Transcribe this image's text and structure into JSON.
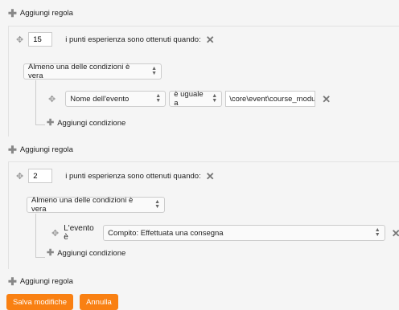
{
  "add_rule_label": "Aggiungi regola",
  "add_condition_label": "Aggiungi condizione",
  "rules": [
    {
      "points": "15",
      "obtained_text": "i punti esperienza sono ottenuti quando:",
      "mode": "Almeno una delle condizioni è vera",
      "condition": {
        "property": "Nome dell'evento",
        "operator": "è uguale a",
        "value": "\\core\\event\\course_modu"
      }
    },
    {
      "points": "2",
      "obtained_text": "i punti esperienza sono ottenuti quando:",
      "mode": "Almeno una delle condizioni è vera",
      "condition": {
        "label": "L'evento è",
        "event": "Compito: Effettuata una consegna"
      }
    }
  ],
  "buttons": {
    "save": "Salva modifiche",
    "cancel": "Annulla"
  },
  "colors": {
    "accent": "#f98012"
  }
}
